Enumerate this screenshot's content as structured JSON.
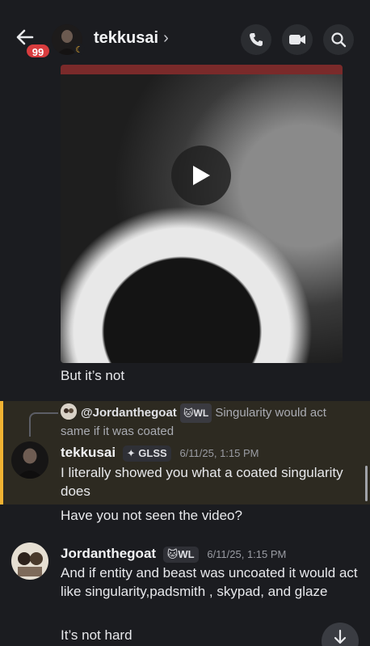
{
  "header": {
    "name": "tekkusai",
    "chevron": "›",
    "unread_badge": "99",
    "status": "idle-moon"
  },
  "messages": [
    {
      "type": "video",
      "caption": "But it’s not"
    },
    {
      "reply_to": {
        "user": "@Jordanthegoat",
        "tag": "WL",
        "text": "Singularity would act same if it was coated"
      },
      "author": "tekkusai",
      "role": "GLSS",
      "time": "6/11/25, 1:15 PM",
      "lines": [
        "I literally showed you what a coated singularity does",
        "Have you not seen the video?"
      ]
    },
    {
      "author": "Jordanthegoat",
      "role": "WL",
      "time": "6/11/25, 1:15 PM",
      "lines": [
        "And if entity and beast was uncoated it would act like singularity,padsmith , skypad, and glaze",
        "It’s not hard"
      ]
    }
  ],
  "icons": {
    "back": "arrow-left-icon",
    "call": "phone-icon",
    "video_call": "video-camera-icon",
    "search": "search-icon",
    "play": "play-icon",
    "jump": "arrow-down-icon"
  },
  "colors": {
    "background": "#1b1c20",
    "highlight": "#2d2a21",
    "highlight_border": "#f0b232",
    "badge": "#d83c3e"
  }
}
